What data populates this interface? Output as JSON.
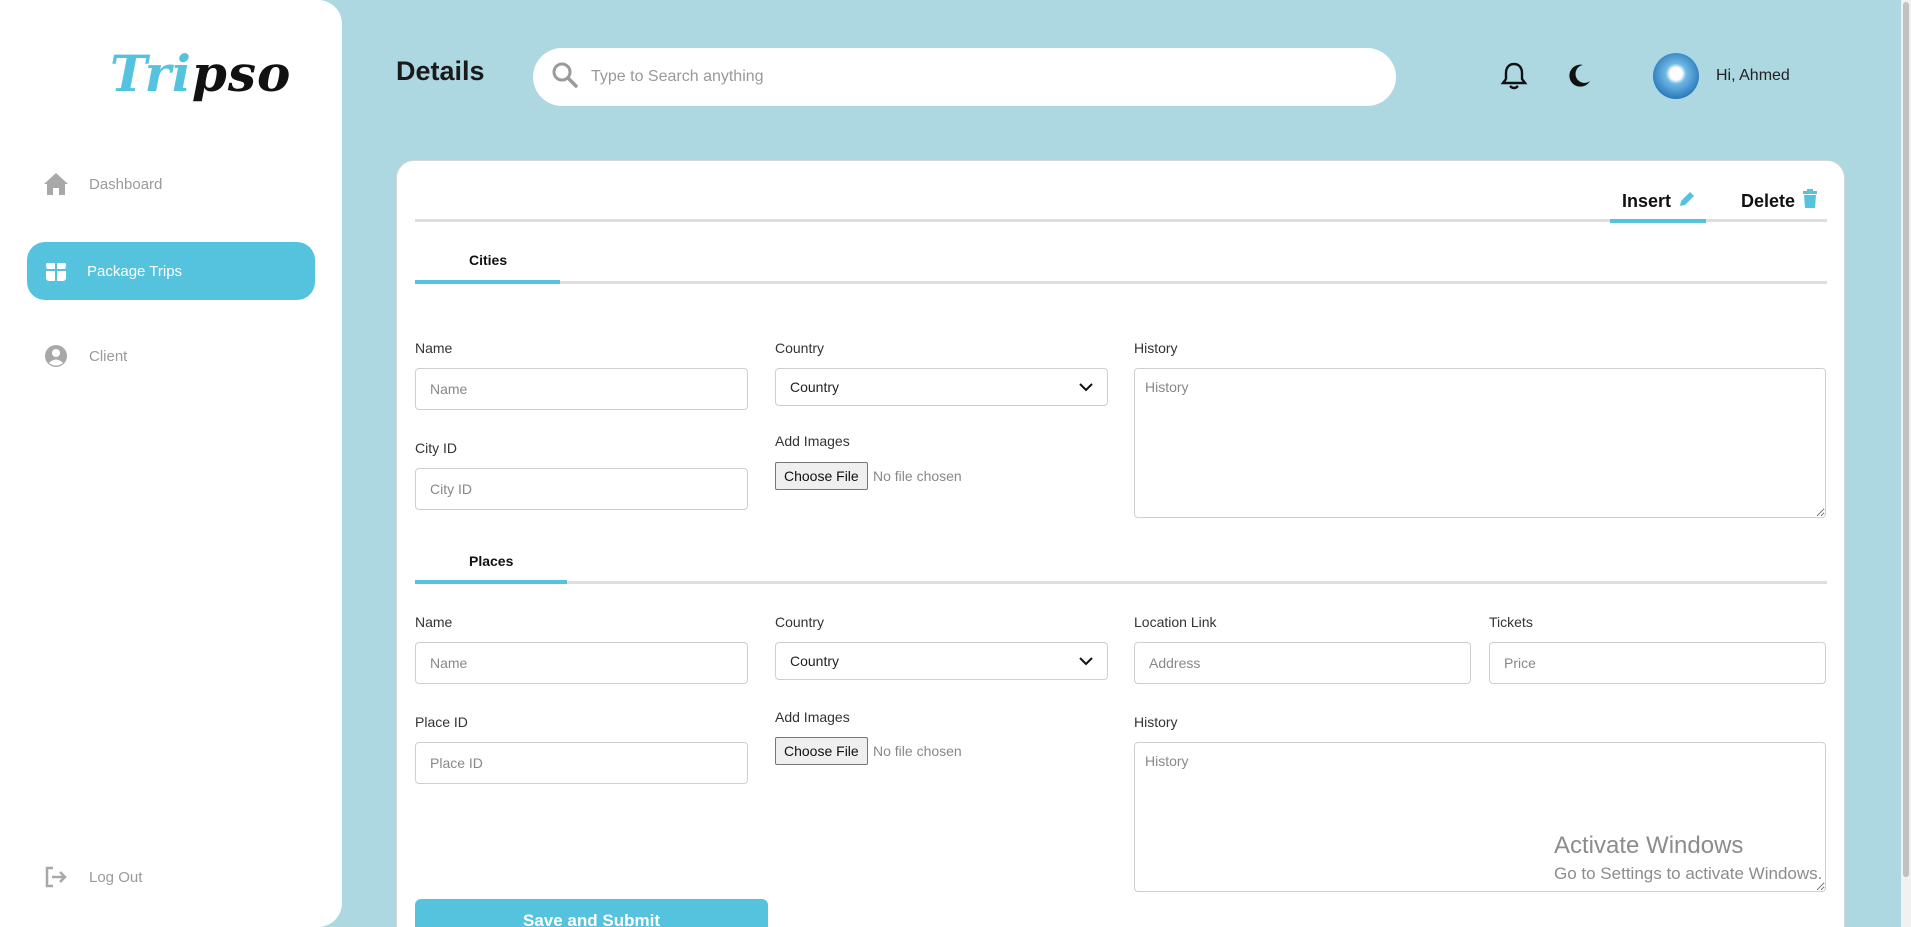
{
  "sidebar": {
    "logo_part1": "Tri",
    "logo_part2": "pso",
    "items": [
      {
        "label": "Dashboard",
        "icon": "home-icon"
      },
      {
        "label": "Package Trips",
        "icon": "gift-icon"
      },
      {
        "label": "Client",
        "icon": "user-circle-icon"
      }
    ],
    "logout_label": "Log Out"
  },
  "header": {
    "title": "Details",
    "search_placeholder": "Type to Search anything",
    "greeting": "Hi, Ahmed"
  },
  "tabs": {
    "insert_label": "Insert",
    "delete_label": "Delete"
  },
  "cities": {
    "section_label": "Cities",
    "name_label": "Name",
    "name_placeholder": "Name",
    "country_label": "Country",
    "country_value": "Country",
    "history_label": "History",
    "history_placeholder": "History",
    "city_id_label": "City ID",
    "city_id_placeholder": "City ID",
    "add_images_label": "Add Images",
    "choose_file_label": "Choose File",
    "no_file_text": "No file chosen"
  },
  "places": {
    "section_label": "Places",
    "name_label": "Name",
    "name_placeholder": "Name",
    "country_label": "Country",
    "country_value": "Country",
    "location_label": "Location Link",
    "location_placeholder": "Address",
    "tickets_label": "Tickets",
    "tickets_placeholder": "Price",
    "place_id_label": "Place ID",
    "place_id_placeholder": "Place ID",
    "add_images_label": "Add Images",
    "choose_file_label": "Choose File",
    "no_file_text": "No file chosen",
    "history_label": "History",
    "history_placeholder": "History"
  },
  "submit_label": "Save and Submit",
  "watermark": {
    "line1": "Activate Windows",
    "line2": "Go to Settings to activate Windows."
  },
  "colors": {
    "background": "#add8e1",
    "accent": "#56c3de"
  }
}
